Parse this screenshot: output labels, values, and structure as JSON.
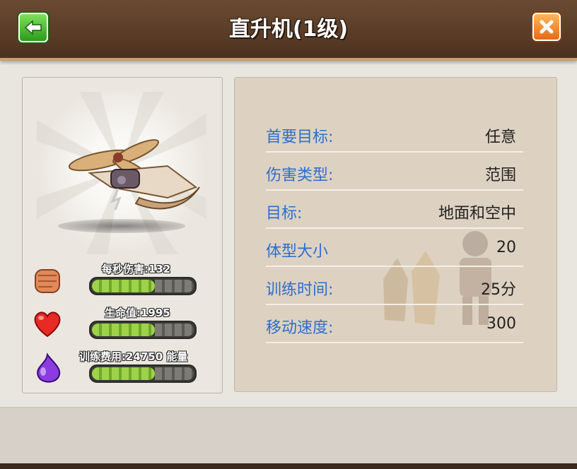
{
  "header": {
    "title": "直升机(1级)",
    "back_icon": "arrow-left-icon",
    "close_icon": "close-x-icon"
  },
  "stats": [
    {
      "icon": "fist-icon",
      "text": "每秒伤害:132",
      "fill": 0.62
    },
    {
      "icon": "heart-icon",
      "text": "生命值:1995",
      "fill": 0.62
    },
    {
      "icon": "elixir-drop-icon",
      "text": "训练费用:24750 能量",
      "fill": 0.62
    }
  ],
  "info": [
    {
      "label": "首要目标:",
      "value": "任意"
    },
    {
      "label": "伤害类型:",
      "value": "范围"
    },
    {
      "label": "目标:",
      "value": "地面和空中"
    },
    {
      "label": "体型大小",
      "value": "20"
    },
    {
      "label": "训练时间:",
      "value": "25分"
    },
    {
      "label": "移动速度:",
      "value": "300"
    }
  ],
  "colors": {
    "header_bg": "#5a3c26",
    "label_blue": "#2b6fd0",
    "bar_green": "#9ed24a",
    "back_green": "#2c9a1c",
    "close_orange": "#e56a14"
  }
}
